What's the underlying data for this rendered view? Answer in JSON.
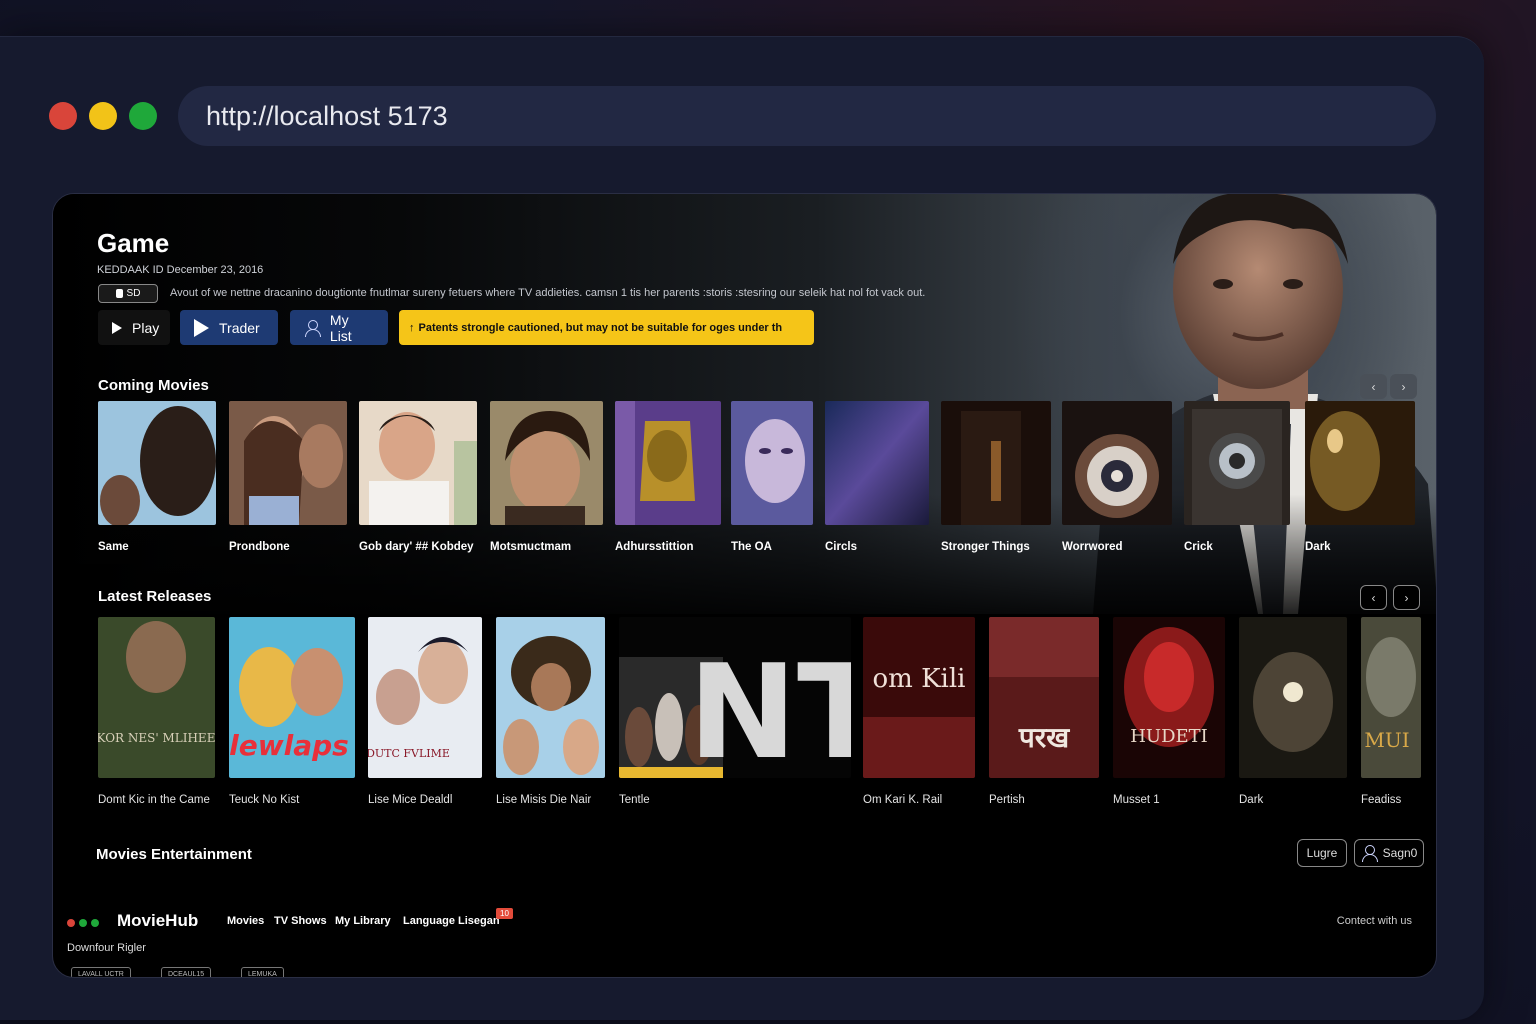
{
  "browser": {
    "url": "http://localhost 5173"
  },
  "hero": {
    "title": "Game",
    "meta": "KEDDAAK ID December 23, 2016",
    "badge": "SD",
    "description": "Avout of we nettne dracanino dougtionte fnutlmar sureny fetuers where TV addieties. camsn 1 tis her parents :storis :stesring our seleik hat nol fot vack out.",
    "play_label": "Play",
    "trailer_label": "Trader",
    "mylist_label": "My List",
    "warning": "Patents strongle cautioned, but may not be suitable for oges under th",
    "warning_icon": "↑"
  },
  "coming": {
    "title": "Coming Movies",
    "prev": "‹",
    "next": "›",
    "items": [
      {
        "label": "Same"
      },
      {
        "label": "Prondbone"
      },
      {
        "label": "Gob dary' ## Kobdey"
      },
      {
        "label": "Motsmuctmam"
      },
      {
        "label": "Adhursstittion"
      },
      {
        "label": "The OA"
      },
      {
        "label": "Circls"
      },
      {
        "label": "Stronger Things"
      },
      {
        "label": "Worrwored"
      },
      {
        "label": "Crick"
      },
      {
        "label": "Dark"
      }
    ]
  },
  "latest": {
    "title": "Latest Releases",
    "prev": "‹",
    "next": "›",
    "items": [
      {
        "label": "Domt Kic in the Came",
        "poster_text": "KOR NES' MLIHEE"
      },
      {
        "label": "Teuck No Kist",
        "poster_text": "lewlaps"
      },
      {
        "label": "Lise Mice Dealdl",
        "poster_text": "DUTC FVLIME"
      },
      {
        "label": "Lise Misis Die Nair"
      },
      {
        "label": "Tentle",
        "poster_text": "NT"
      },
      {
        "label": "Om Kari K. Rail",
        "poster_text": "om Kili"
      },
      {
        "label": "Pertish",
        "poster_text": "परख"
      },
      {
        "label": "Musset 1",
        "poster_text": "HUDETI"
      },
      {
        "label": "Dark"
      },
      {
        "label": "Feadiss",
        "poster_text": "MUI"
      }
    ]
  },
  "footer": {
    "title": "Movies Entertainment",
    "login": "Lugre",
    "signup": "Sagn0",
    "brand": "MovieHub",
    "nav": [
      "Movies",
      "TV Shows",
      "My Library",
      "Language Lisegan"
    ],
    "new_badge": "10",
    "contact": "Contect with us",
    "sub": "Downfour Rigler",
    "tiny_pills": [
      "LAVALL UCTR",
      "DCEAUL15",
      "LEMUKA"
    ]
  }
}
